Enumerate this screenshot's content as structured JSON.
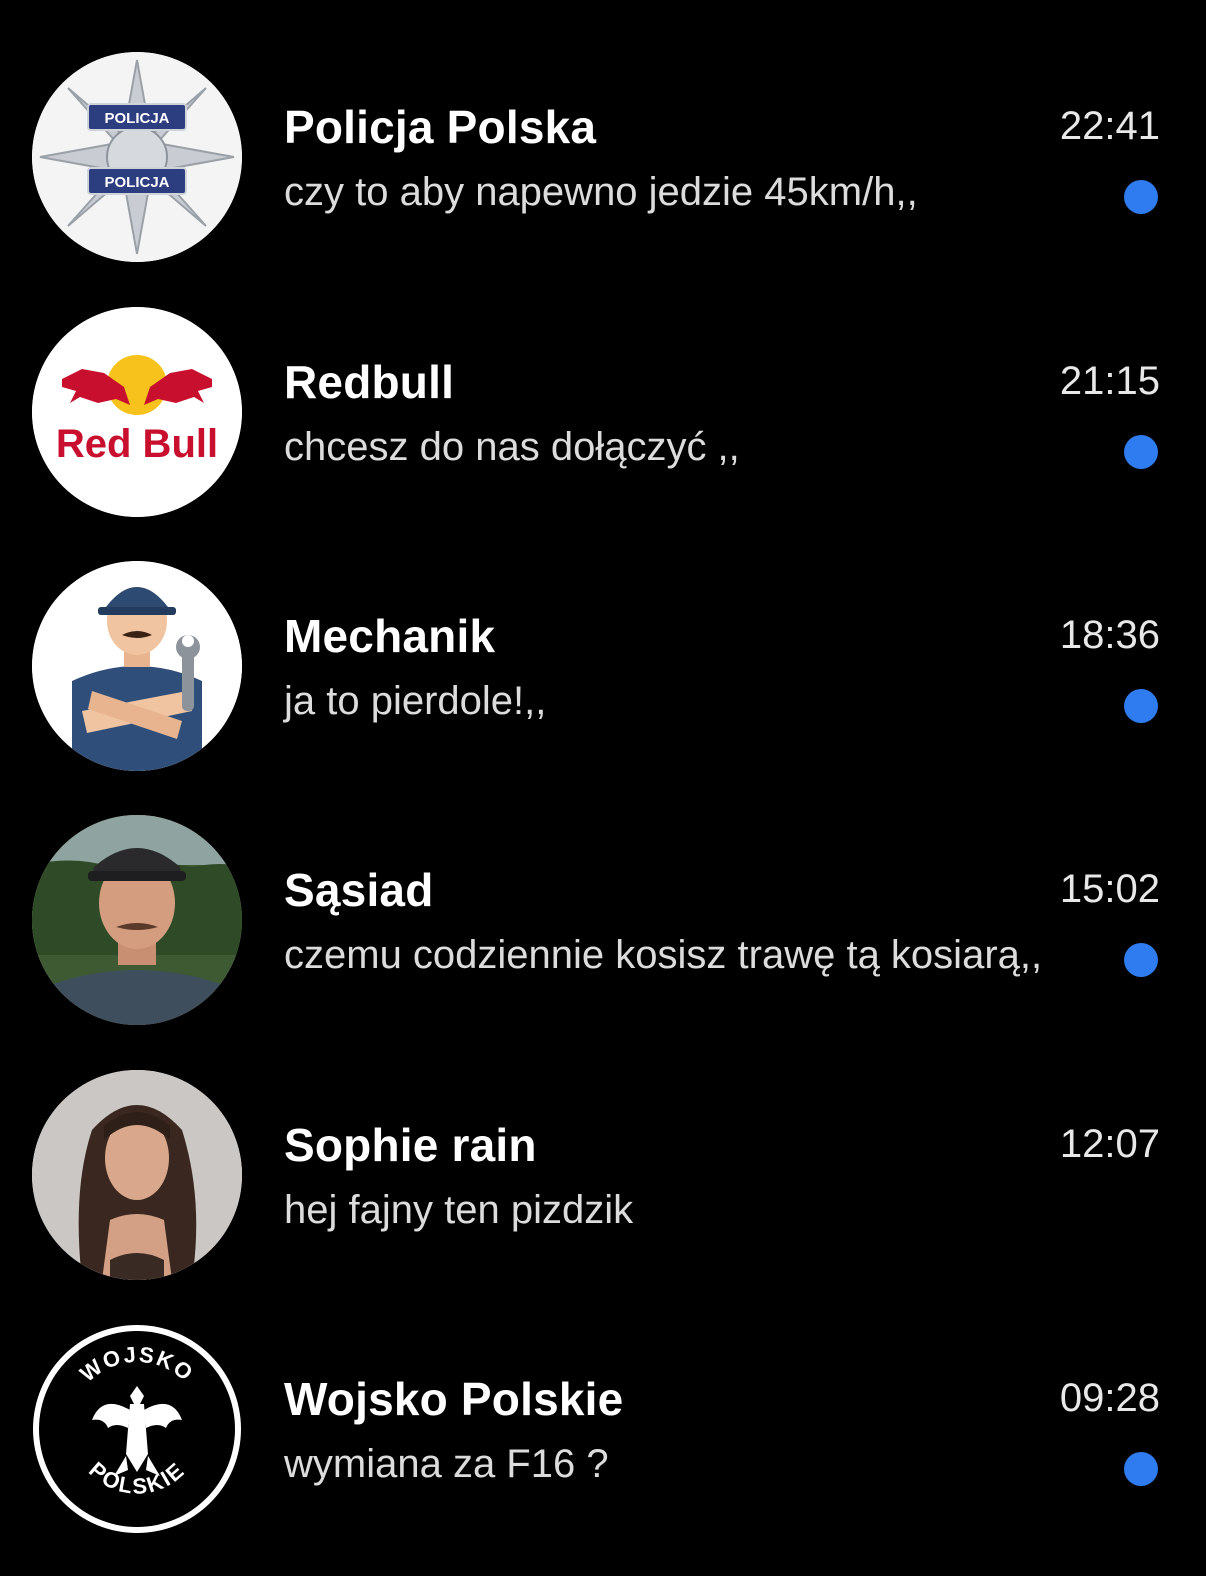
{
  "accent_color": "#2f7bf0",
  "chats": [
    {
      "name": "Policja Polska",
      "time": "22:41",
      "message": "czy to aby napewno jedzie 45km/h,,",
      "unread": true,
      "avatar": "police-badge-icon",
      "avatar_text": [
        "POLICJA",
        "POLICJA"
      ]
    },
    {
      "name": "Redbull",
      "time": "21:15",
      "message": "chcesz do nas dołączyć ,,",
      "unread": true,
      "avatar": "redbull-logo",
      "avatar_text": [
        "Red Bull"
      ]
    },
    {
      "name": "Mechanik",
      "time": "18:36",
      "message": "ja to pierdole!,,",
      "unread": true,
      "avatar": "mechanic-illustration"
    },
    {
      "name": "Sąsiad",
      "time": "15:02",
      "message": "czemu codziennie kosisz trawę tą kosiarą,,",
      "unread": true,
      "avatar": "neighbor-photo"
    },
    {
      "name": "Sophie rain",
      "time": "12:07",
      "message": "hej fajny ten pizdzik",
      "unread": false,
      "avatar": "woman-photo"
    },
    {
      "name": "Wojsko Polskie",
      "time": "09:28",
      "message": "wymiana za F16 ?",
      "unread": true,
      "avatar": "eagle-emblem-icon",
      "avatar_text": [
        "WOJSKO",
        "POLSKIE"
      ]
    }
  ]
}
